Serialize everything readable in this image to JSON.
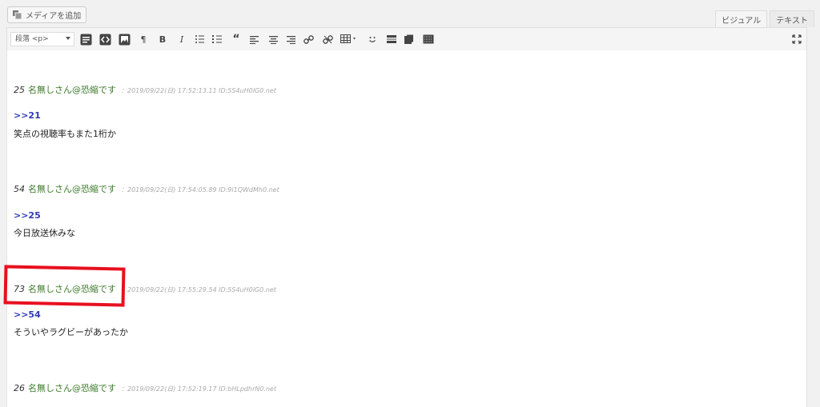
{
  "toolbar_top": {
    "add_media_label": "メディアを追加",
    "tabs": [
      {
        "label": "ビジュアル",
        "active": true
      },
      {
        "label": "テキスト",
        "active": false
      }
    ]
  },
  "format_toolbar": {
    "format_select_value": "段落 <p>"
  },
  "posts": [
    {
      "number": "25",
      "name": "名無しさん@恐縮です",
      "meta": "：2019/09/22(日) 17:52:13.11 ID:5S4uH0lG0.net",
      "reply": ">>21",
      "text": "笑点の視聴率もまた1桁か"
    },
    {
      "number": "54",
      "name": "名無しさん@恐縮です",
      "meta": "：2019/09/22(日) 17:54:05.89 ID:9l1QWdMh0.net",
      "reply": ">>25",
      "text": "今日放送休みな"
    },
    {
      "number": "73",
      "name": "名無しさん@恐縮です",
      "meta": "：2019/09/22(日) 17:55:29.54 ID:5S4uH0lG0.net",
      "reply": ">>54",
      "text": "そういやラグビーがあったか"
    },
    {
      "number": "26",
      "name": "名無しさん@恐縮です",
      "meta": "：2019/09/22(日) 17:52:19.17 ID:bHLpdhrN0.net",
      "reply": "",
      "text": ""
    }
  ],
  "colors": {
    "name_green": "#3d7a2c",
    "reply_blue": "#2e3bb8",
    "highlight_red": "#e8101e"
  }
}
